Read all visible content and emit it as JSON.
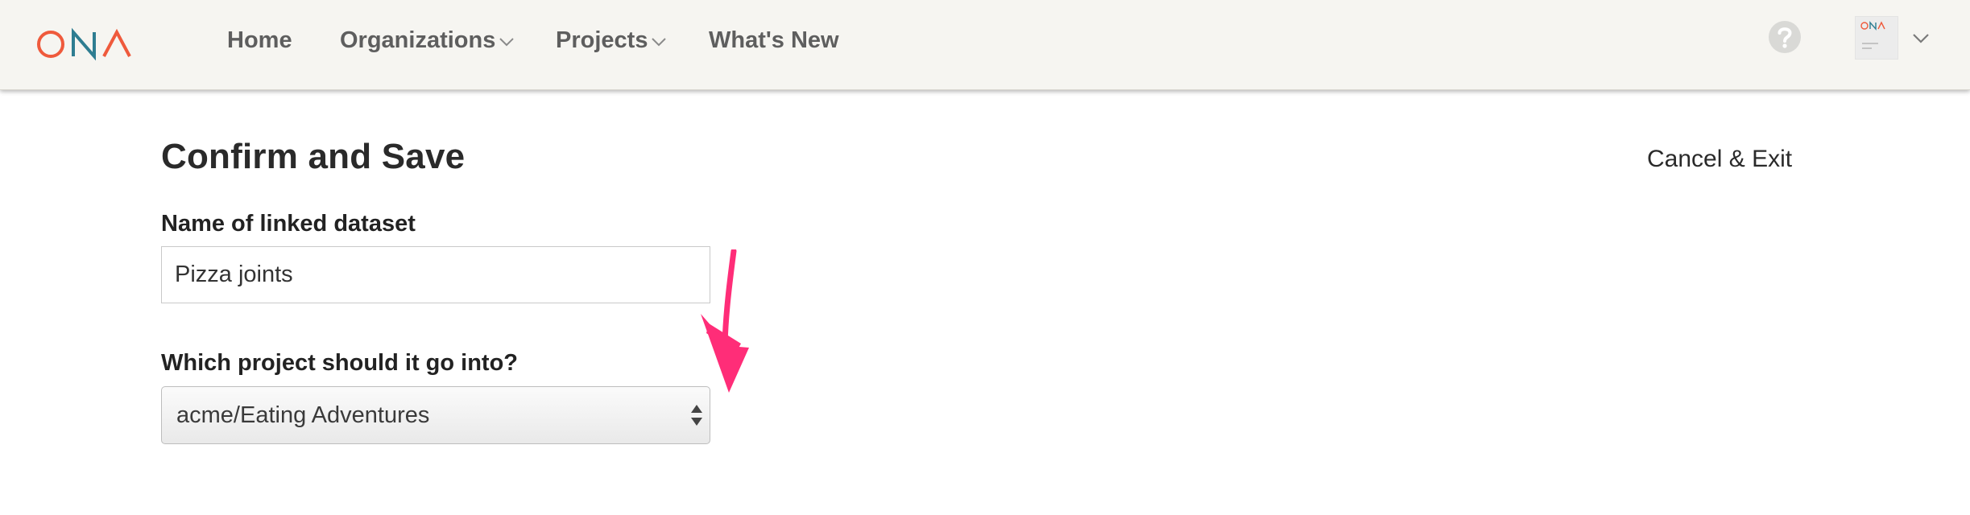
{
  "header": {
    "logo_text": "ONA",
    "nav": [
      {
        "label": "Home"
      },
      {
        "label": "Organizations"
      },
      {
        "label": "Projects"
      },
      {
        "label": "What's New"
      }
    ],
    "help_icon": "question-mark-icon",
    "avatar_icon": "user-avatar",
    "dropdown_icon": "chevron-down-icon"
  },
  "main": {
    "title": "Confirm and Save",
    "cancel_label": "Cancel & Exit",
    "name_field": {
      "label": "Name of linked dataset",
      "value": "Pizza joints"
    },
    "project_field": {
      "label": "Which project should it go into?",
      "selected": "acme/Eating Adventures"
    }
  },
  "colors": {
    "brand_orange": "#ef5a3c",
    "brand_teal": "#2e7d91",
    "header_bg": "#f6f5f1",
    "annotation_pink": "#ff2d78"
  }
}
